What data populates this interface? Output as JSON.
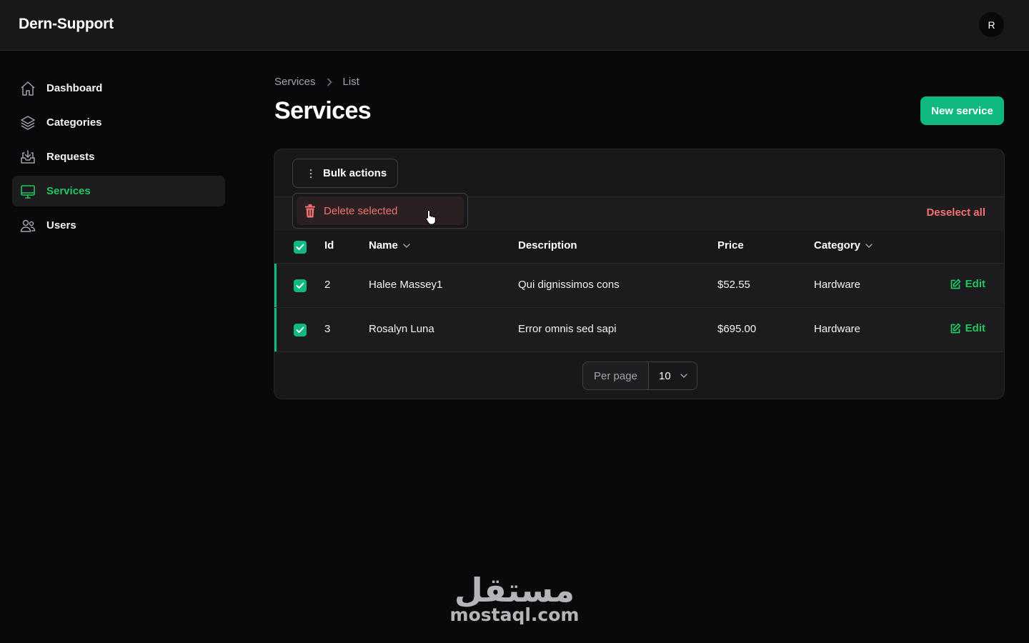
{
  "app": {
    "brand": "Dern-Support",
    "avatar_initial": "R"
  },
  "sidebar": {
    "items": [
      {
        "label": "Dashboard",
        "icon": "home-icon",
        "active": false
      },
      {
        "label": "Categories",
        "icon": "layers-icon",
        "active": false
      },
      {
        "label": "Requests",
        "icon": "inbox-icon",
        "active": false
      },
      {
        "label": "Services",
        "icon": "monitor-icon",
        "active": true
      },
      {
        "label": "Users",
        "icon": "users-icon",
        "active": false
      }
    ]
  },
  "breadcrumb": {
    "items": [
      "Services",
      "List"
    ]
  },
  "page": {
    "title": "Services",
    "new_button": "New service"
  },
  "table": {
    "bulk_actions_label": "Bulk actions",
    "dropdown": {
      "delete_label": "Delete selected"
    },
    "deselect_label": "Deselect all",
    "columns": {
      "id": "Id",
      "name": "Name",
      "description": "Description",
      "price": "Price",
      "category": "Category"
    },
    "rows": [
      {
        "id": "2",
        "name": "Halee Massey1",
        "description": "Qui dignissimos cons",
        "price": "$52.55",
        "category": "Hardware",
        "edit": "Edit",
        "checked": true
      },
      {
        "id": "3",
        "name": "Rosalyn Luna",
        "description": "Error omnis sed sapi",
        "price": "$695.00",
        "category": "Hardware",
        "edit": "Edit",
        "checked": true
      }
    ],
    "pagination": {
      "per_page_label": "Per page",
      "per_page_value": "10"
    }
  },
  "watermark": {
    "arabic": "مستقل",
    "latin": "mostaql.com"
  },
  "colors": {
    "accent": "#10b981",
    "danger": "#f87171",
    "background": "#09090b",
    "surface": "#18181b"
  }
}
